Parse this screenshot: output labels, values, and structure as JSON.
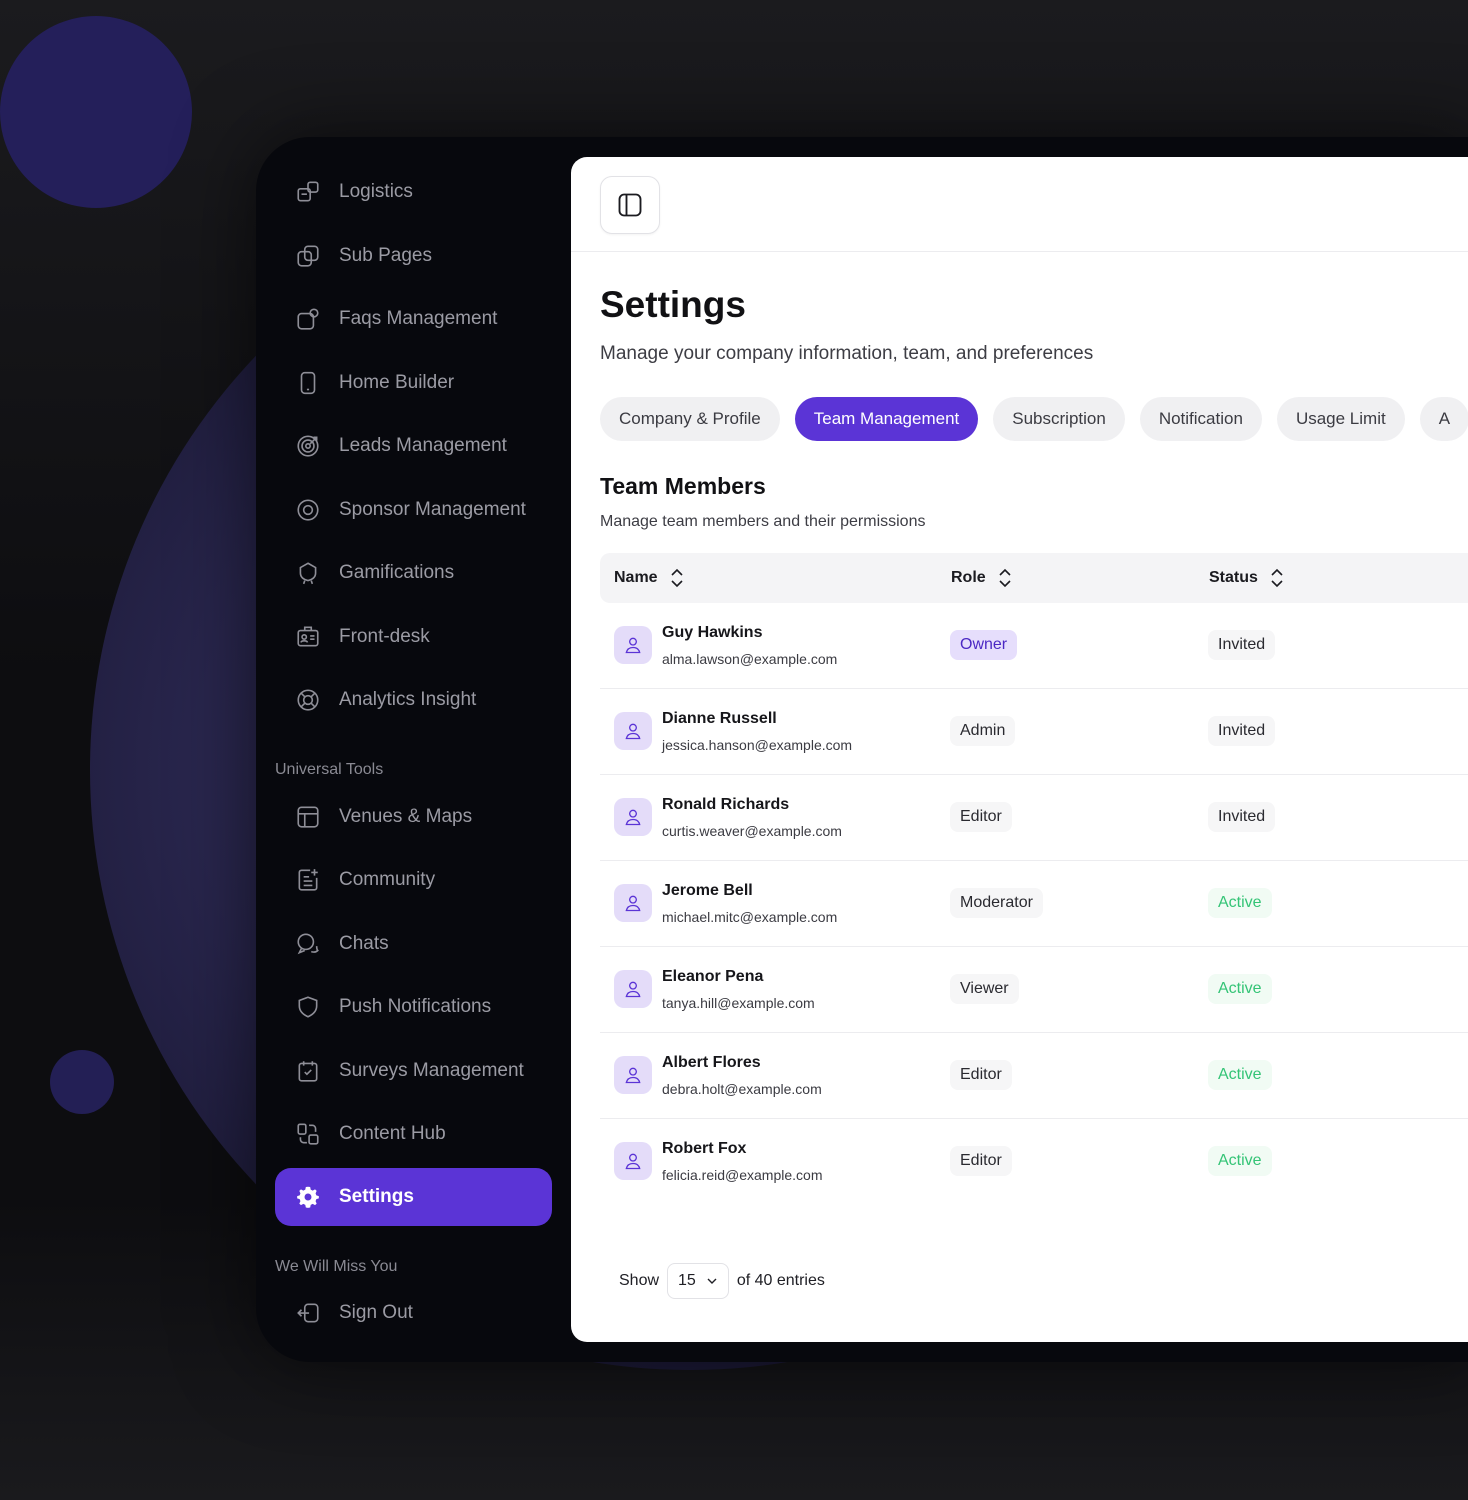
{
  "sidebar": {
    "items": [
      {
        "label": "Logistics",
        "icon": "logistics-icon"
      },
      {
        "label": "Sub Pages",
        "icon": "sub-pages-icon"
      },
      {
        "label": "Faqs Management",
        "icon": "faqs-icon"
      },
      {
        "label": "Home Builder",
        "icon": "phone-icon"
      },
      {
        "label": "Leads Management",
        "icon": "target-icon"
      },
      {
        "label": "Sponsor Management",
        "icon": "circle-dot-icon"
      },
      {
        "label": "Gamifications",
        "icon": "badge-icon"
      },
      {
        "label": "Front-desk",
        "icon": "id-card-icon"
      },
      {
        "label": "Analytics Insight",
        "icon": "lifebuoy-icon"
      }
    ],
    "universal_tools_label": "Universal Tools",
    "tools": [
      {
        "label": "Venues & Maps",
        "icon": "layout-icon"
      },
      {
        "label": "Community",
        "icon": "list-edit-icon"
      },
      {
        "label": "Chats",
        "icon": "chat-icon"
      },
      {
        "label": "Push Notifications",
        "icon": "shield-icon"
      },
      {
        "label": "Surveys Management",
        "icon": "calendar-check-icon"
      },
      {
        "label": "Content Hub",
        "icon": "shapes-icon"
      },
      {
        "label": "Settings",
        "icon": "gear-icon"
      }
    ],
    "miss_you_label": "We Will Miss You",
    "sign_out_label": "Sign Out"
  },
  "header": {
    "title": "Settings",
    "subtitle": "Manage your company information, team, and preferences"
  },
  "tabs": [
    {
      "label": "Company & Profile"
    },
    {
      "label": "Team Management"
    },
    {
      "label": "Subscription"
    },
    {
      "label": "Notification"
    },
    {
      "label": "Usage Limit"
    },
    {
      "label": "A"
    }
  ],
  "team": {
    "title": "Team Members",
    "subtitle": "Manage team members and their permissions",
    "columns": {
      "name": "Name",
      "role": "Role",
      "status": "Status"
    },
    "members": [
      {
        "name": "Guy Hawkins",
        "email": "alma.lawson@example.com",
        "role": "Owner",
        "status": "Invited"
      },
      {
        "name": "Dianne Russell",
        "email": "jessica.hanson@example.com",
        "role": "Admin",
        "status": "Invited"
      },
      {
        "name": "Ronald Richards",
        "email": "curtis.weaver@example.com",
        "role": "Editor",
        "status": "Invited"
      },
      {
        "name": "Jerome Bell",
        "email": "michael.mitc@example.com",
        "role": "Moderator",
        "status": "Active"
      },
      {
        "name": "Eleanor Pena",
        "email": "tanya.hill@example.com",
        "role": "Viewer",
        "status": "Active"
      },
      {
        "name": "Albert Flores",
        "email": "debra.holt@example.com",
        "role": "Editor",
        "status": "Active"
      },
      {
        "name": "Robert Fox",
        "email": "felicia.reid@example.com",
        "role": "Editor",
        "status": "Active"
      }
    ]
  },
  "pagination": {
    "show_label": "Show",
    "page_size": "15",
    "entries_label": "of 40 entries"
  },
  "colors": {
    "accent": "#5b34d6",
    "active_status": "#34c476",
    "sidebar_bg": "#07080d"
  }
}
